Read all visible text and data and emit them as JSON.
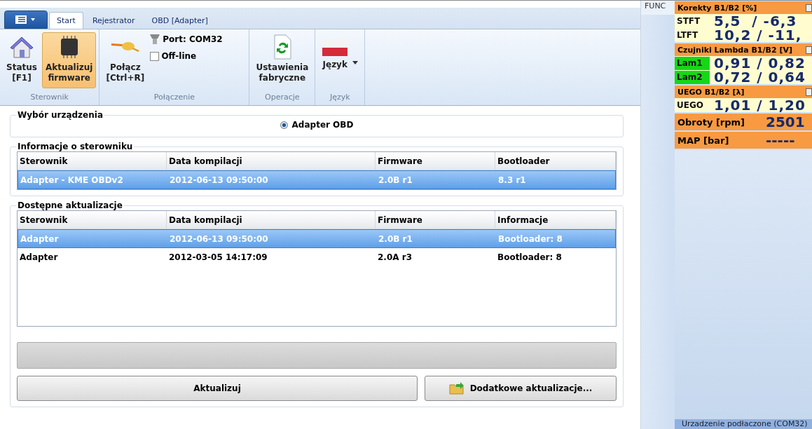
{
  "tabs": [
    {
      "label": "Start",
      "selected": true
    },
    {
      "label": "Rejestrator",
      "selected": false
    },
    {
      "label": "OBD  [Adapter]",
      "selected": false
    }
  ],
  "ribbon_groups": [
    {
      "label": "Sterownik",
      "items": [
        {
          "kind": "big",
          "label": "Status\n[F1]",
          "selected": false
        },
        {
          "kind": "big",
          "label": "Aktualizuj\nfirmware",
          "selected": true
        }
      ]
    },
    {
      "label": "Połączenie",
      "items": [
        {
          "kind": "big",
          "label": "Połącz\n[Ctrl+R]",
          "selected": false
        },
        {
          "kind": "port",
          "label": "Port: COM32"
        },
        {
          "kind": "check",
          "label": "Off-line",
          "checked": false
        }
      ]
    },
    {
      "label": "Operacje",
      "items": [
        {
          "kind": "big",
          "label": "Ustawienia\nfabryczne",
          "selected": false
        }
      ]
    },
    {
      "label": "Język",
      "items": [
        {
          "kind": "dropdown",
          "label": "Język"
        }
      ]
    }
  ],
  "device_selection": {
    "title": "Wybór urządzenia",
    "option": {
      "label": "Adapter OBD",
      "selected": true
    }
  },
  "controller_info": {
    "title": "Informacje o sterowniku",
    "columns": [
      "Sterownik",
      "Data kompilacji",
      "Firmware",
      "Bootloader"
    ],
    "rows": [
      {
        "cells": [
          "Adapter - KME OBDv2",
          "2012-06-13 09:50:00",
          "2.0B r1",
          "8.3 r1"
        ],
        "selected": true
      }
    ]
  },
  "updates": {
    "title": "Dostępne aktualizacje",
    "columns": [
      "Sterownik",
      "Data kompilacji",
      "Firmware",
      "Informacje"
    ],
    "rows": [
      {
        "cells": [
          "Adapter",
          "2012-06-13 09:50:00",
          "2.0B r1",
          "Bootloader: 8"
        ],
        "selected": true
      },
      {
        "cells": [
          "Adapter",
          "2012-03-05 14:17:09",
          "2.0A r3",
          "Bootloader: 8"
        ],
        "selected": false
      }
    ],
    "progress": {
      "level": 0
    },
    "buttons": [
      "Aktualizuj",
      "Dodatkowe aktualizacje..."
    ]
  },
  "side_label": "FUNC",
  "gauges": [
    {
      "kind": "group",
      "title": "Korekty B1/B2 [%]",
      "rows": [
        {
          "label": "STFT",
          "value": "5,5  / -6,3",
          "highlight": false
        },
        {
          "label": "LTFT",
          "value": "10,2 / -11,",
          "highlight": false
        }
      ]
    },
    {
      "kind": "group",
      "title": "Czujniki Lambda B1/B2 [V]",
      "rows": [
        {
          "label": "Lam1",
          "value": "0,91 / 0,82",
          "highlight": true
        },
        {
          "label": "Lam2",
          "value": "0,72 / 0,64",
          "highlight": true
        }
      ]
    },
    {
      "kind": "group",
      "title": "UEGO B1/B2 [λ]",
      "rows": [
        {
          "label": "UEGO",
          "value": "1,01 / 1,20",
          "highlight": false
        }
      ]
    },
    {
      "kind": "single",
      "label": "Obroty [rpm]",
      "value": "2501"
    },
    {
      "kind": "single",
      "label": "MAP [bar]",
      "value": "-----"
    }
  ],
  "status_bar": "Urzadzenie podłaczone (COM32)"
}
